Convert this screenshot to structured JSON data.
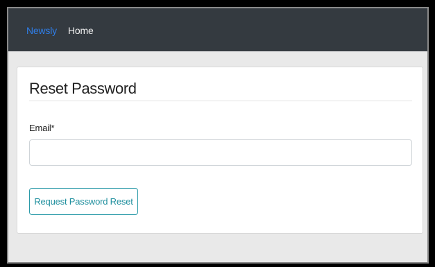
{
  "navbar": {
    "brand": "Newsly",
    "links": [
      {
        "label": "Home"
      }
    ]
  },
  "card": {
    "title": "Reset Password",
    "email_field": {
      "label": "Email*",
      "value": "",
      "placeholder": ""
    },
    "submit_label": "Request Password Reset"
  },
  "colors": {
    "navbar_bg": "#343a40",
    "brand": "#2f7ee8",
    "button_accent": "#1f8f9e",
    "page_bg": "#e9e9e9"
  }
}
